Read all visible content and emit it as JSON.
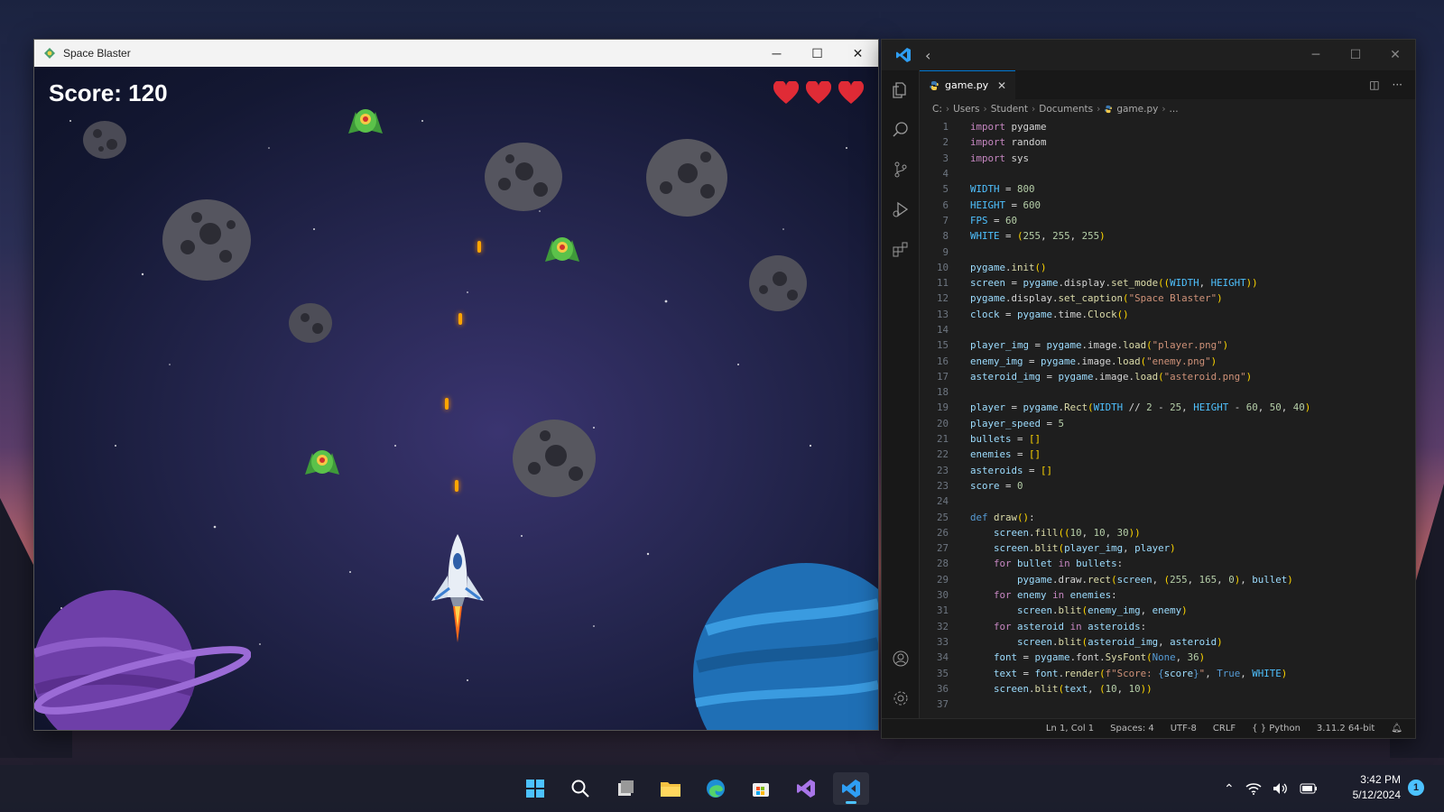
{
  "game_window": {
    "title": "Space Blaster",
    "controls": {
      "minimize": "─",
      "maximize": "☐",
      "close": "✕"
    },
    "score_text": "Score: 120",
    "lives": 3,
    "colors": {
      "heart": "#e02b36",
      "bullet": "#ffa500"
    }
  },
  "vscode": {
    "tab": {
      "filename": "game.py",
      "close": "✕"
    },
    "breadcrumb": [
      "C:",
      "Users",
      "Student",
      "Documents",
      "game.py",
      "..."
    ],
    "code_lines": [
      {
        "n": "1",
        "html": "<span class='kw'>import</span> pygame"
      },
      {
        "n": "2",
        "html": "<span class='kw'>import</span> random"
      },
      {
        "n": "3",
        "html": "<span class='kw'>import</span> sys"
      },
      {
        "n": "4",
        "html": ""
      },
      {
        "n": "5",
        "html": "<span class='const'>WIDTH</span> = <span class='num'>800</span>"
      },
      {
        "n": "6",
        "html": "<span class='const'>HEIGHT</span> = <span class='num'>600</span>"
      },
      {
        "n": "7",
        "html": "<span class='const'>FPS</span> = <span class='num'>60</span>"
      },
      {
        "n": "8",
        "html": "<span class='const'>WHITE</span> = <span class='br'>(</span><span class='num'>255</span>, <span class='num'>255</span>, <span class='num'>255</span><span class='br'>)</span>"
      },
      {
        "n": "9",
        "html": ""
      },
      {
        "n": "10",
        "html": "<span class='var'>pygame</span>.<span class='fn'>init</span><span class='br'>()</span>"
      },
      {
        "n": "11",
        "html": "<span class='var'>screen</span> = <span class='var'>pygame</span>.display.<span class='fn'>set_mode</span><span class='br'>((</span><span class='const'>WIDTH</span>, <span class='const'>HEIGHT</span><span class='br'>))</span>"
      },
      {
        "n": "12",
        "html": "<span class='var'>pygame</span>.display.<span class='fn'>set_caption</span><span class='br'>(</span><span class='str'>\"Space Blaster\"</span><span class='br'>)</span>"
      },
      {
        "n": "13",
        "html": "<span class='var'>clock</span> = <span class='var'>pygame</span>.time.<span class='fn'>Clock</span><span class='br'>()</span>"
      },
      {
        "n": "14",
        "html": ""
      },
      {
        "n": "15",
        "html": "<span class='var'>player_img</span> = <span class='var'>pygame</span>.image.<span class='fn'>load</span><span class='br'>(</span><span class='str'>\"player.png\"</span><span class='br'>)</span>"
      },
      {
        "n": "16",
        "html": "<span class='var'>enemy_img</span> = <span class='var'>pygame</span>.image.<span class='fn'>load</span><span class='br'>(</span><span class='str'>\"enemy.png\"</span><span class='br'>)</span>"
      },
      {
        "n": "17",
        "html": "<span class='var'>asteroid_img</span> = <span class='var'>pygame</span>.image.<span class='fn'>load</span><span class='br'>(</span><span class='str'>\"asteroid.png\"</span><span class='br'>)</span>"
      },
      {
        "n": "18",
        "html": ""
      },
      {
        "n": "19",
        "html": "<span class='var'>player</span> = <span class='var'>pygame</span>.<span class='fn'>Rect</span><span class='br'>(</span><span class='const'>WIDTH</span> // <span class='num'>2</span> - <span class='num'>25</span>, <span class='const'>HEIGHT</span> - <span class='num'>60</span>, <span class='num'>50</span>, <span class='num'>40</span><span class='br'>)</span>"
      },
      {
        "n": "20",
        "html": "<span class='var'>player_speed</span> = <span class='num'>5</span>"
      },
      {
        "n": "21",
        "html": "<span class='var'>bullets</span> = <span class='br'>[]</span>"
      },
      {
        "n": "22",
        "html": "<span class='var'>enemies</span> = <span class='br'>[]</span>"
      },
      {
        "n": "23",
        "html": "<span class='var'>asteroids</span> = <span class='br'>[]</span>"
      },
      {
        "n": "23",
        "html": "<span class='var'>score</span> = <span class='num'>0</span>"
      },
      {
        "n": "24",
        "html": ""
      },
      {
        "n": "25",
        "html": "<span class='bool'>def</span> <span class='fn'>draw</span><span class='br'>()</span>:"
      },
      {
        "n": "26",
        "html": "    <span class='var'>screen</span>.<span class='fn'>fill</span><span class='br'>((</span><span class='num'>10</span>, <span class='num'>10</span>, <span class='num'>30</span><span class='br'>))</span>"
      },
      {
        "n": "27",
        "html": "    <span class='var'>screen</span>.<span class='fn'>blit</span><span class='br'>(</span><span class='var'>player_img</span>, <span class='var'>player</span><span class='br'>)</span>"
      },
      {
        "n": "28",
        "html": "    <span class='kw'>for</span> <span class='var'>bullet</span> <span class='kw'>in</span> <span class='var'>bullets</span>:"
      },
      {
        "n": "29",
        "html": "        <span class='var'>pygame</span>.draw.<span class='fn'>rect</span><span class='br'>(</span><span class='var'>screen</span>, <span class='br'>(</span><span class='num'>255</span>, <span class='num'>165</span>, <span class='num'>0</span><span class='br'>)</span>, <span class='var'>bullet</span><span class='br'>)</span>"
      },
      {
        "n": "30",
        "html": "    <span class='kw'>for</span> <span class='var'>enemy</span> <span class='kw'>in</span> <span class='var'>enemies</span>:"
      },
      {
        "n": "31",
        "html": "        <span class='var'>screen</span>.<span class='fn'>blit</span><span class='br'>(</span><span class='var'>enemy_img</span>, <span class='var'>enemy</span><span class='br'>)</span>"
      },
      {
        "n": "32",
        "html": "    <span class='kw'>for</span> <span class='var'>asteroid</span> <span class='kw'>in</span> <span class='var'>asteroids</span>:"
      },
      {
        "n": "33",
        "html": "        <span class='var'>screen</span>.<span class='fn'>blit</span><span class='br'>(</span><span class='var'>asteroid_img</span>, <span class='var'>asteroid</span><span class='br'>)</span>"
      },
      {
        "n": "34",
        "html": "    <span class='var'>font</span> = <span class='var'>pygame</span>.font.<span class='fn'>SysFont</span><span class='br'>(</span><span class='bool'>None</span>, <span class='num'>36</span><span class='br'>)</span>"
      },
      {
        "n": "35",
        "html": "    <span class='var'>text</span> = <span class='var'>font</span>.<span class='fn'>render</span><span class='br'>(</span><span class='str'>f\"Score: </span><span class='bool'>{</span><span class='var'>score</span><span class='bool'>}</span><span class='str'>\"</span>, <span class='bool'>True</span>, <span class='const'>WHITE</span><span class='br'>)</span>"
      },
      {
        "n": "36",
        "html": "    <span class='var'>screen</span>.<span class='fn'>blit</span><span class='br'>(</span><span class='var'>text</span>, <span class='br'>(</span><span class='num'>10</span>, <span class='num'>10</span><span class='br'>))</span>"
      },
      {
        "n": "37",
        "html": ""
      }
    ],
    "status": {
      "position": "Ln 1, Col 1",
      "spaces": "Spaces: 4",
      "encoding": "UTF-8",
      "eol": "CRLF",
      "language": "Python",
      "interpreter": "3.11.2 64-bit"
    }
  },
  "taskbar": {
    "apps": [
      "start-icon",
      "search-icon",
      "task-view-icon",
      "file-explorer-icon",
      "edge-icon",
      "store-icon",
      "visual-studio-icon",
      "vscode-icon"
    ],
    "time": "3:42 PM",
    "date": "5/12/2024",
    "notification_count": "1"
  }
}
